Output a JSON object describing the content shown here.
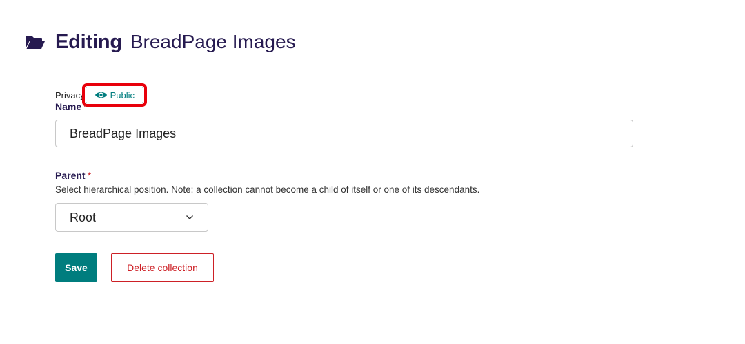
{
  "header": {
    "icon": "folder-open-icon",
    "verb": "Editing",
    "title": "BreadPage Images"
  },
  "privacy": {
    "label": "Privacy",
    "badge_icon": "eye-icon",
    "badge_label": "Public",
    "highlight_color": "#e8000b"
  },
  "name_field": {
    "label": "Name",
    "required_marker": "*",
    "value": "BreadPage Images"
  },
  "parent_field": {
    "label": "Parent",
    "required_marker": "*",
    "help_text": "Select hierarchical position. Note: a collection cannot become a child of itself or one of its descendants.",
    "selected": "Root",
    "icon": "chevron-down-icon"
  },
  "actions": {
    "save_label": "Save",
    "delete_label": "Delete collection"
  },
  "colors": {
    "primary": "#007d7e",
    "heading": "#261a50",
    "danger": "#cd2026"
  }
}
